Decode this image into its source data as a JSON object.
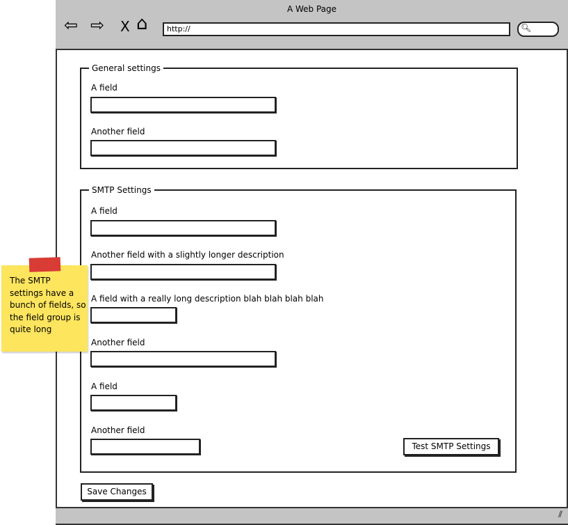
{
  "browser": {
    "title": "A Web Page",
    "url": "http://",
    "icons": [
      "back-arrow-icon",
      "forward-arrow-icon",
      "close-x-icon",
      "home-icon",
      "search-icon",
      "resize-grip-icon"
    ]
  },
  "general": {
    "legend": "General settings",
    "fields": [
      {
        "label": "A field",
        "value": ""
      },
      {
        "label": "Another field",
        "value": ""
      }
    ]
  },
  "smtp": {
    "legend": "SMTP Settings",
    "fields": [
      {
        "label": "A field",
        "value": ""
      },
      {
        "label": "Another field with a slightly longer description",
        "value": ""
      },
      {
        "label": "A field with a really long description blah blah blah blah",
        "value": ""
      },
      {
        "label": "Another field",
        "value": ""
      },
      {
        "label": "A field",
        "value": ""
      },
      {
        "label": "Another field",
        "value": ""
      }
    ],
    "test_button": "Test SMTP Settings"
  },
  "save_button": "Save Changes",
  "note": {
    "text": "The SMTP settings have a bunch of fields, so the field group is quite long",
    "color": "#fde55e",
    "tape_color": "#d93b35"
  }
}
